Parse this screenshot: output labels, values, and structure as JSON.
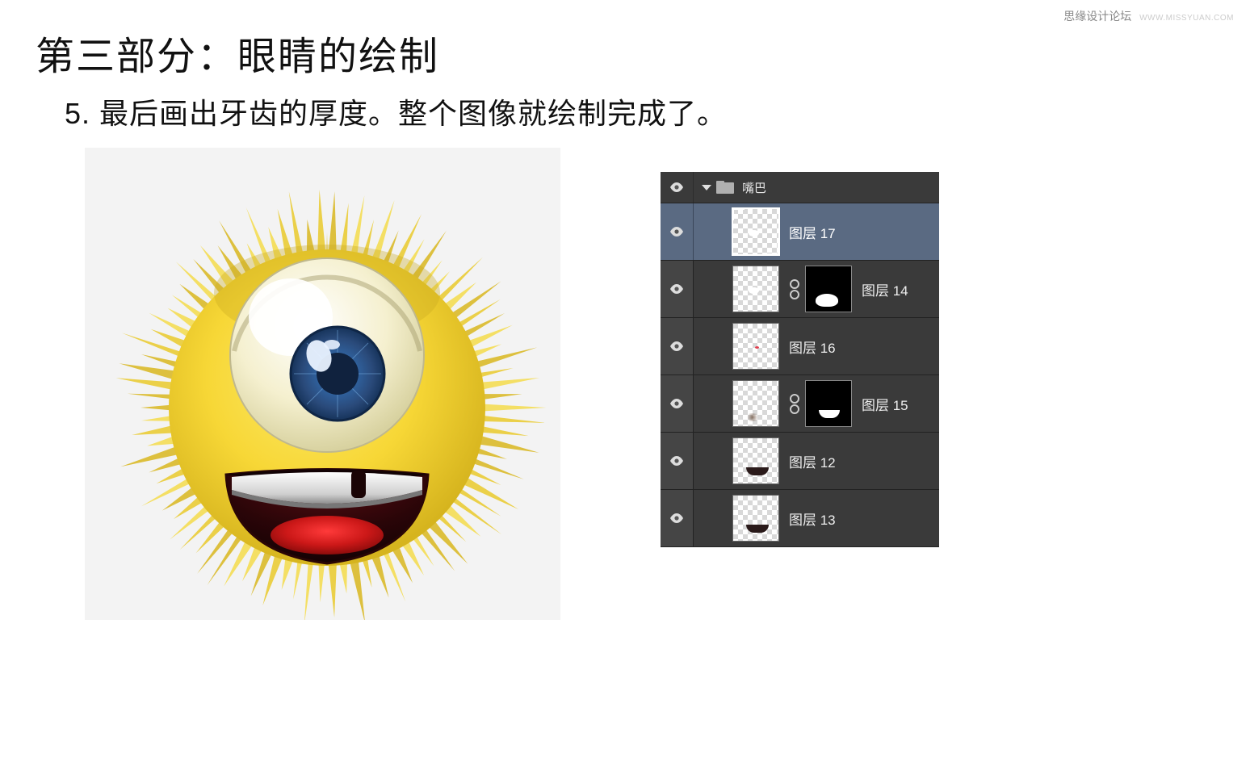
{
  "watermark": {
    "main": "思缘设计论坛",
    "sub": "WWW.MISSYUAN.COM"
  },
  "title": "第三部分：眼睛的绘制",
  "step_text": "5. 最后画出牙齿的厚度。整个图像就绘制完成了。",
  "layers_panel": {
    "group_name": "嘴巴",
    "layers": [
      {
        "id": "l17",
        "label": "图层 17",
        "selected": true,
        "has_mask": false,
        "thumb_kind": "tooth"
      },
      {
        "id": "l14",
        "label": "图层 14",
        "selected": false,
        "has_mask": true,
        "thumb_kind": "tooth",
        "mask_kind": "blob"
      },
      {
        "id": "l16",
        "label": "图层 16",
        "selected": false,
        "has_mask": false,
        "thumb_kind": "red_dot"
      },
      {
        "id": "l15",
        "label": "图层 15",
        "selected": false,
        "has_mask": true,
        "thumb_kind": "spot",
        "mask_kind": "smile"
      },
      {
        "id": "l12",
        "label": "图层 12",
        "selected": false,
        "has_mask": false,
        "thumb_kind": "mouth"
      },
      {
        "id": "l13",
        "label": "图层 13",
        "selected": false,
        "has_mask": false,
        "thumb_kind": "mouth"
      }
    ]
  }
}
